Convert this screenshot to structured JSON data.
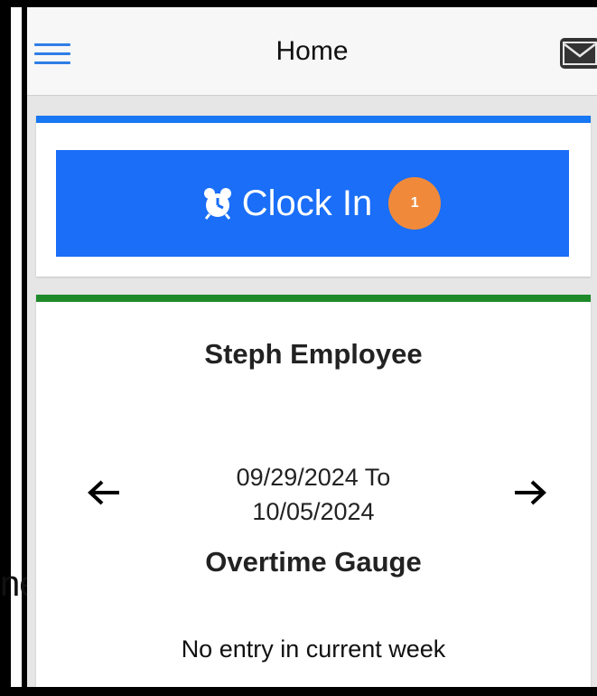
{
  "header": {
    "title": "Home",
    "menu_icon": "hamburger-menu-icon",
    "mail_icon": "envelope-icon"
  },
  "clock_card": {
    "button_label": "Clock In",
    "button_icon": "alarm-clock-icon",
    "badge_count": "1",
    "accent_color": "#1877f2",
    "button_color": "#1a6ef7",
    "badge_color": "#f08a3a"
  },
  "employee_card": {
    "accent_color": "#1f8a2a",
    "employee_name": "Steph Employee",
    "date_range_line1": "09/29/2024 To",
    "date_range_line2": "10/05/2024",
    "prev_icon": "arrow-left-icon",
    "next_icon": "arrow-right-icon",
    "gauge_title": "Overtime Gauge",
    "status_text": "No entry in current week"
  },
  "background_fragment": "ne"
}
